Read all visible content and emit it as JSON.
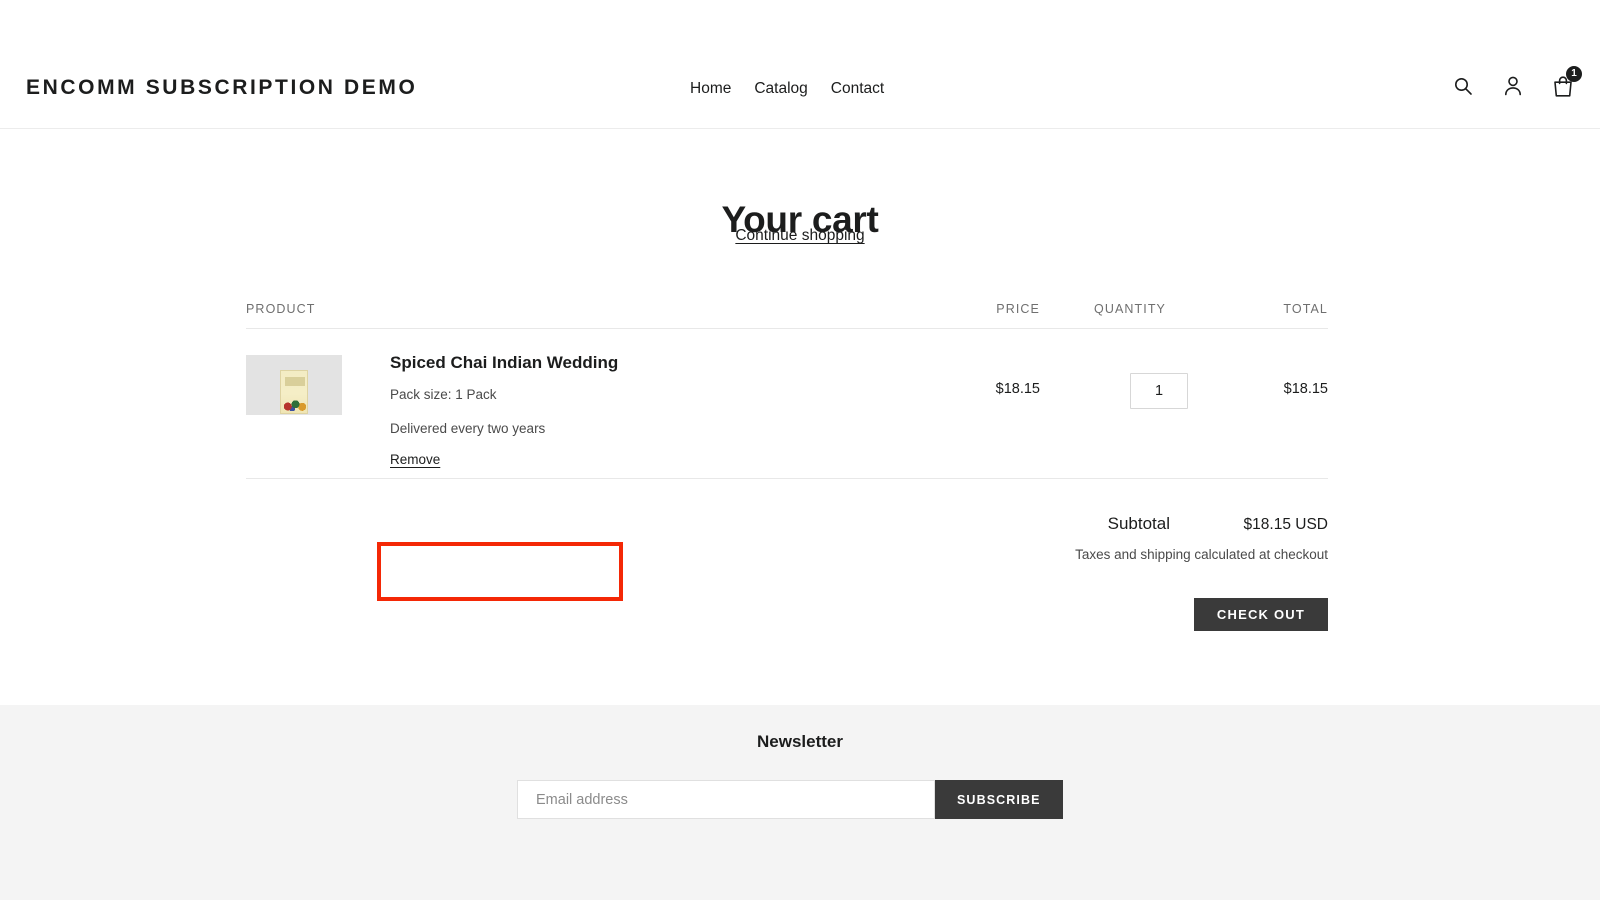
{
  "header": {
    "logo": "ENCOMM SUBSCRIPTION DEMO",
    "nav": [
      {
        "label": "Home"
      },
      {
        "label": "Catalog"
      },
      {
        "label": "Contact"
      }
    ],
    "icons": {
      "search": "search-icon",
      "account": "account-icon",
      "cart": "cart-icon"
    },
    "cart_count": "1"
  },
  "cart": {
    "title": "Your cart",
    "continue_shopping": "Continue shopping",
    "columns": {
      "product": "PRODUCT",
      "price": "PRICE",
      "quantity": "QUANTITY",
      "total": "TOTAL"
    },
    "items": [
      {
        "title": "Spiced Chai Indian Wedding",
        "variant": "Pack size: 1 Pack",
        "subscription": "Delivered every two years",
        "remove_label": "Remove",
        "price": "$18.15",
        "quantity": "1",
        "total": "$18.15"
      }
    ],
    "subtotal_label": "Subtotal",
    "subtotal_value": "$18.15 USD",
    "tax_note": "Taxes and shipping calculated at checkout",
    "checkout_label": "CHECK OUT"
  },
  "footer": {
    "newsletter_title": "Newsletter",
    "email_placeholder": "Email address",
    "subscribe_label": "SUBSCRIBE"
  },
  "annotation": {
    "color": "#f42806"
  }
}
